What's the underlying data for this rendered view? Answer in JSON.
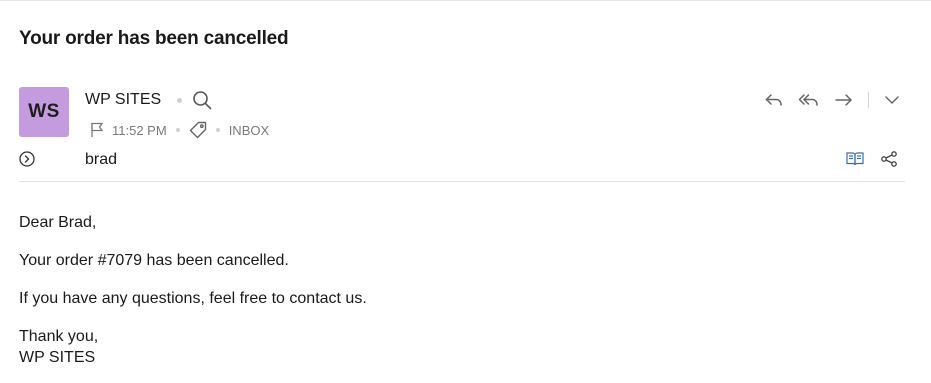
{
  "email": {
    "subject": "Your order has been cancelled",
    "avatar_initials": "WS",
    "avatar_color": "#c39bde",
    "sender": "WP SITES",
    "time": "11:52 PM",
    "folder": "INBOX",
    "to": "brad"
  },
  "actions": {
    "reply": "reply-icon",
    "reply_all": "reply-all-icon",
    "forward": "forward-icon",
    "more": "chevron-down-icon"
  },
  "body": {
    "greeting": "Dear Brad,",
    "line1": "Your order #7079 has been cancelled.",
    "line2": "If you have any questions, feel free to contact us.",
    "closing": "Thank you,",
    "signature": "WP SITES"
  }
}
